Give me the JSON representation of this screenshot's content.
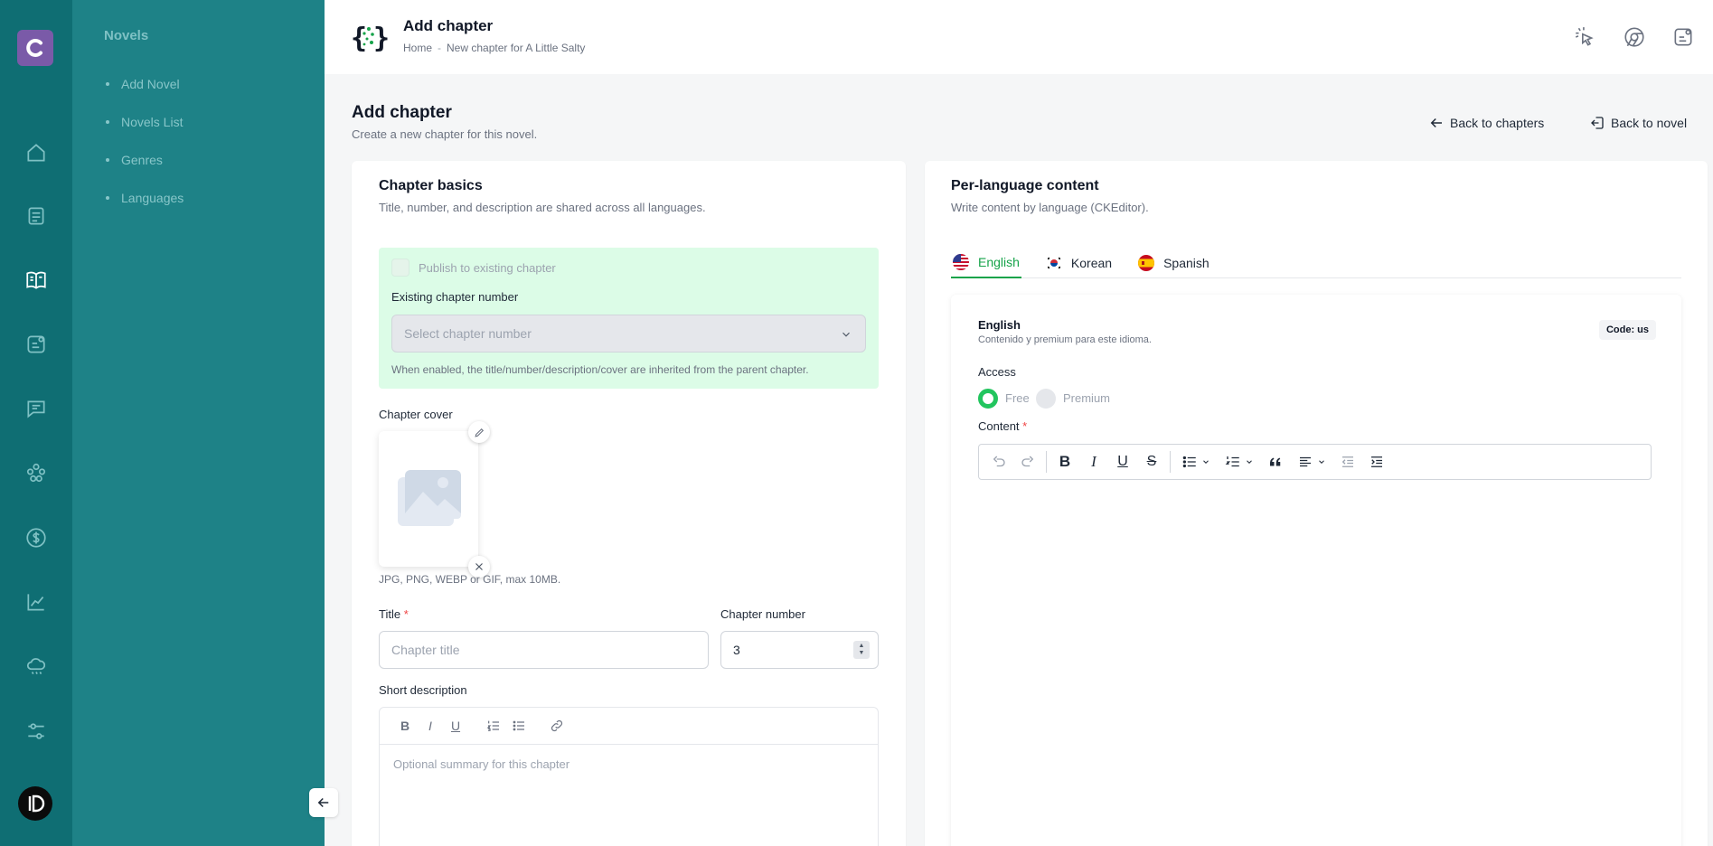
{
  "subnav": {
    "heading": "Novels",
    "items": [
      "Add Novel",
      "Novels List",
      "Genres",
      "Languages"
    ]
  },
  "topbar": {
    "title": "Add chapter",
    "breadcrumb": [
      "Home",
      "New chapter for A Little Salty"
    ],
    "breadcrumb_sep": "-"
  },
  "page": {
    "title": "Add chapter",
    "subtitle": "Create a new chapter for this novel.",
    "back_chapters": "Back to chapters",
    "back_novel": "Back to novel"
  },
  "basics": {
    "title": "Chapter basics",
    "desc": "Title, number, and description are shared across all languages.",
    "publish_label": "Publish to existing chapter",
    "existing_label": "Existing chapter number",
    "existing_placeholder": "Select chapter number",
    "publish_hint": "When enabled, the title/number/description/cover are inherited from the parent chapter.",
    "cover_label": "Chapter cover",
    "cover_hint": "JPG, PNG, WEBP or GIF, max 10MB.",
    "title_label": "Title",
    "required_mark": "*",
    "title_placeholder": "Chapter title",
    "number_label": "Chapter number",
    "number_value": "3",
    "short_desc_label": "Short description",
    "short_desc_placeholder": "Optional summary for this chapter",
    "mini_toolbar": [
      "B",
      "I",
      "U"
    ]
  },
  "content": {
    "title": "Per-language content",
    "desc": "Write content by language (CKEditor).",
    "tabs": [
      "English",
      "Korean",
      "Spanish"
    ],
    "active_tab": "English",
    "lang_name": "English",
    "lang_sub": "Contenido y premium para este idioma.",
    "code": "Code: us",
    "access_label": "Access",
    "access_options": [
      "Free",
      "Premium"
    ],
    "access_selected": "Free",
    "content_label": "Content",
    "editor_toolbar": [
      "B",
      "I",
      "U",
      "S"
    ]
  },
  "colors": {
    "rail": "#0f6e73",
    "subnav": "#1e8287",
    "accent": "#16a34a",
    "publish_bg": "#dcfce7"
  }
}
